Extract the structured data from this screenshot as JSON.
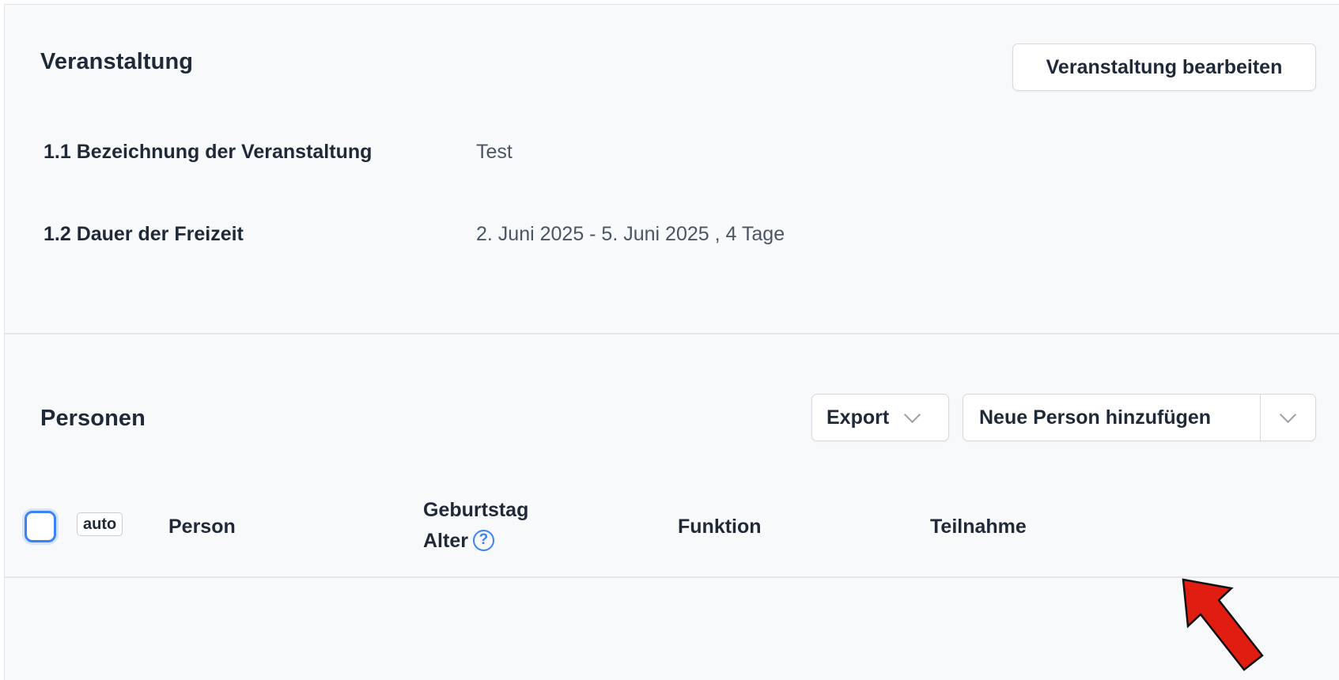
{
  "event_section": {
    "title": "Veranstaltung",
    "edit_button": "Veranstaltung bearbeiten",
    "fields": [
      {
        "label": "1.1 Bezeichnung der Veranstaltung",
        "value": "Test"
      },
      {
        "label": "1.2 Dauer der Freizeit",
        "value": "2. Juni 2025 - 5. Juni 2025 , 4 Tage"
      }
    ]
  },
  "persons_section": {
    "title": "Personen",
    "export_button": "Export",
    "add_person_button": "Neue Person hinzufügen",
    "table": {
      "auto_badge": "auto",
      "columns": {
        "person": "Person",
        "birthday": "Geburtstag",
        "age": "Alter",
        "function": "Funktion",
        "participation": "Teilnahme"
      }
    }
  },
  "icons": {
    "help": "question-circle-icon",
    "chevron": "chevron-down-icon",
    "annotation": "red-arrow-icon"
  },
  "colors": {
    "accent": "#3b82f6",
    "annotation_arrow": "#e11d12"
  }
}
